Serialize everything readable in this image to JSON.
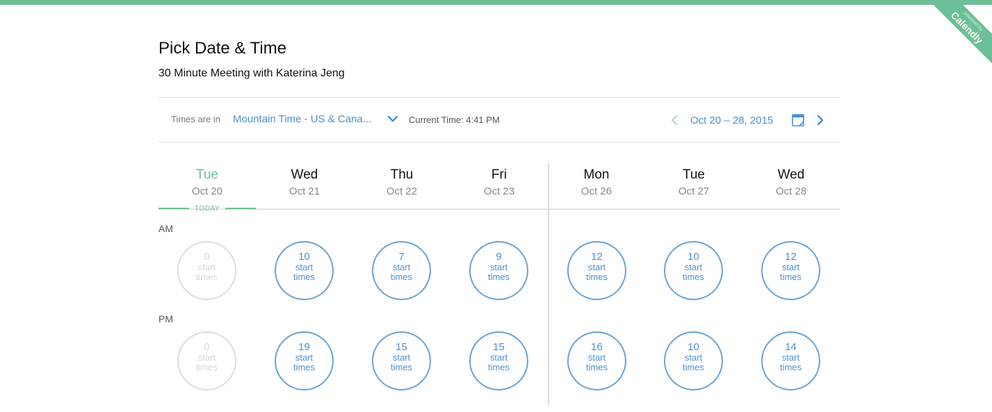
{
  "branding": {
    "powered_by": "powered by",
    "name": "Calendly"
  },
  "header": {
    "title": "Pick Date & Time",
    "subtitle": "30 Minute Meeting with Katerina Jeng"
  },
  "toolbar": {
    "timezone_label": "Times are in",
    "timezone_value": "Mountain Time - US & Cana...",
    "current_time": "Current Time: 4:41 PM",
    "date_range": "Oct 20 – 28, 2015"
  },
  "today_label": "TODAY",
  "periods": {
    "am": "AM",
    "pm": "PM"
  },
  "slot_unit": {
    "line1": "start",
    "line2": "times"
  },
  "days": [
    {
      "name": "Tue",
      "date": "Oct 20",
      "am": "0",
      "pm": "0",
      "today": true
    },
    {
      "name": "Wed",
      "date": "Oct 21",
      "am": "10",
      "pm": "19"
    },
    {
      "name": "Thu",
      "date": "Oct 22",
      "am": "7",
      "pm": "15"
    },
    {
      "name": "Fri",
      "date": "Oct 23",
      "am": "9",
      "pm": "15"
    },
    {
      "name": "Mon",
      "date": "Oct 26",
      "am": "12",
      "pm": "16"
    },
    {
      "name": "Tue",
      "date": "Oct 27",
      "am": "10",
      "pm": "10"
    },
    {
      "name": "Wed",
      "date": "Oct 28",
      "am": "12",
      "pm": "14"
    }
  ],
  "colors": {
    "accent_green": "#6cbf97",
    "link_blue": "#4a90d2",
    "disabled": "#dcd7cc"
  },
  "icons": {
    "timezone_dropdown": "chevron-down-icon",
    "prev": "chevron-left-icon",
    "next": "chevron-right-icon",
    "calendar": "calendar-icon"
  }
}
